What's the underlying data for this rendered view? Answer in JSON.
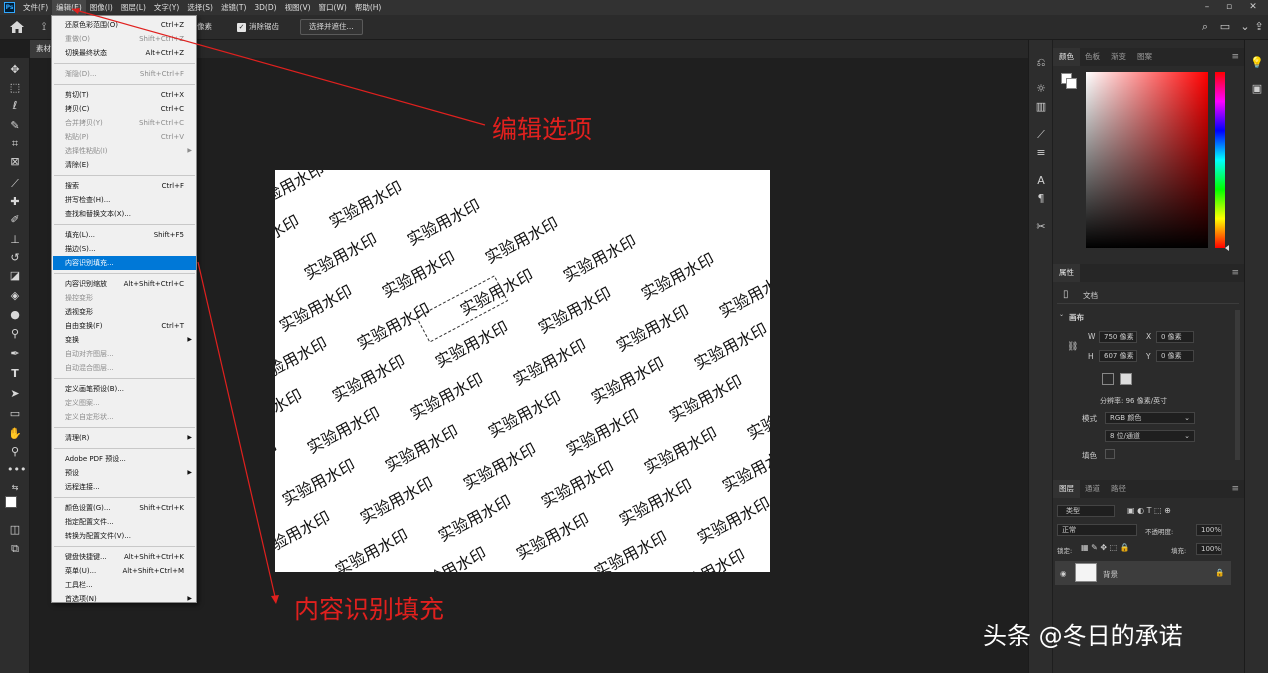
{
  "menubar": {
    "logo": "Ps",
    "items": [
      "文件(F)",
      "编辑(E)",
      "图像(I)",
      "图层(L)",
      "文字(Y)",
      "选择(S)",
      "滤镜(T)",
      "3D(D)",
      "视图(V)",
      "窗口(W)",
      "帮助(H)"
    ],
    "active_index": 1
  },
  "optbar": {
    "partial_text": "像素",
    "antialias_label": "消除锯齿",
    "select_subject_label": "选择并遮住..."
  },
  "tab": {
    "label": "素材"
  },
  "edit_menu": {
    "items": [
      {
        "label": "还原色彩范围(O)",
        "shortcut": "Ctrl+Z",
        "disabled": false
      },
      {
        "label": "重做(O)",
        "shortcut": "Shift+Ctrl+Z",
        "disabled": true
      },
      {
        "label": "切换最终状态",
        "shortcut": "Alt+Ctrl+Z",
        "disabled": false
      },
      {
        "sep": true
      },
      {
        "label": "渐隐(D)...",
        "shortcut": "Shift+Ctrl+F",
        "disabled": true
      },
      {
        "sep": true
      },
      {
        "label": "剪切(T)",
        "shortcut": "Ctrl+X",
        "disabled": false
      },
      {
        "label": "拷贝(C)",
        "shortcut": "Ctrl+C",
        "disabled": false
      },
      {
        "label": "合并拷贝(Y)",
        "shortcut": "Shift+Ctrl+C",
        "disabled": true
      },
      {
        "label": "粘贴(P)",
        "shortcut": "Ctrl+V",
        "disabled": true
      },
      {
        "label": "选择性粘贴(I)",
        "submenu": true,
        "disabled": true
      },
      {
        "label": "清除(E)",
        "disabled": false
      },
      {
        "sep": true
      },
      {
        "label": "搜索",
        "shortcut": "Ctrl+F",
        "disabled": false
      },
      {
        "label": "拼写检查(H)...",
        "disabled": false
      },
      {
        "label": "查找和替换文本(X)...",
        "disabled": false
      },
      {
        "sep": true
      },
      {
        "label": "填充(L)...",
        "shortcut": "Shift+F5",
        "disabled": false
      },
      {
        "label": "描边(S)...",
        "disabled": false
      },
      {
        "label": "内容识别填充...",
        "disabled": false,
        "highlight": true
      },
      {
        "sep": true
      },
      {
        "label": "内容识别缩放",
        "shortcut": "Alt+Shift+Ctrl+C",
        "disabled": false
      },
      {
        "label": "操控变形",
        "disabled": true
      },
      {
        "label": "透视变形",
        "disabled": false
      },
      {
        "label": "自由变换(F)",
        "shortcut": "Ctrl+T",
        "disabled": false
      },
      {
        "label": "变换",
        "submenu": true,
        "disabled": false
      },
      {
        "label": "自动对齐图层...",
        "disabled": true
      },
      {
        "label": "自动混合图层...",
        "disabled": true
      },
      {
        "sep": true
      },
      {
        "label": "定义画笔预设(B)...",
        "disabled": false
      },
      {
        "label": "定义图案...",
        "disabled": true
      },
      {
        "label": "定义自定形状...",
        "disabled": true
      },
      {
        "sep": true
      },
      {
        "label": "清理(R)",
        "submenu": true,
        "disabled": false
      },
      {
        "sep": true
      },
      {
        "label": "Adobe PDF 预设...",
        "disabled": false
      },
      {
        "label": "预设",
        "submenu": true,
        "disabled": false
      },
      {
        "label": "远程连接...",
        "disabled": false
      },
      {
        "sep": true
      },
      {
        "label": "颜色设置(G)...",
        "shortcut": "Shift+Ctrl+K",
        "disabled": false
      },
      {
        "label": "指定配置文件...",
        "disabled": false
      },
      {
        "label": "转换为配置文件(V)...",
        "disabled": false
      },
      {
        "sep": true
      },
      {
        "label": "键盘快捷键...",
        "shortcut": "Alt+Shift+Ctrl+K",
        "disabled": false
      },
      {
        "label": "菜单(U)...",
        "shortcut": "Alt+Shift+Ctrl+M",
        "disabled": false
      },
      {
        "label": "工具栏...",
        "disabled": false
      },
      {
        "label": "首选项(N)",
        "submenu": true,
        "disabled": false
      }
    ]
  },
  "canvas": {
    "watermark_text": "实验用水印",
    "bg": "#ffffff"
  },
  "annotations": {
    "edit_option": "编辑选项",
    "content_aware_fill": "内容识别填充",
    "color": "#e0201e"
  },
  "color_panel": {
    "tabs": [
      "颜色",
      "色板",
      "渐变",
      "图案"
    ]
  },
  "properties_panel": {
    "tab": "属性",
    "doc_label": "文档",
    "section": "画布",
    "w_label": "W",
    "w_value": "750 像素",
    "h_label": "H",
    "h_value": "607 像素",
    "x_label": "X",
    "x_value": "0 像素",
    "y_label": "Y",
    "y_value": "0 像素",
    "resolution": "分辨率: 96 像素/英寸",
    "mode_label": "模式",
    "mode_value": "RGB 颜色",
    "depth_value": "8 位/通道",
    "fill_label": "填色"
  },
  "layers_panel": {
    "tabs": [
      "图层",
      "通道",
      "路径"
    ],
    "kind_filter": "类型",
    "blend_mode": "正常",
    "opacity_label": "不透明度:",
    "opacity_value": "100%",
    "lock_label": "锁定:",
    "fill_label": "填充:",
    "fill_value": "100%",
    "layer_name": "背景"
  },
  "footer_watermark": "头条 @冬日的承诺"
}
